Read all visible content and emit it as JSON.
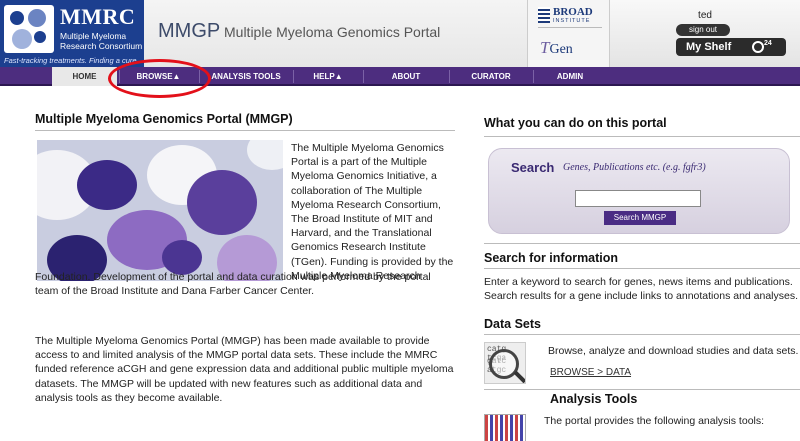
{
  "header": {
    "logo": {
      "title": "MMRC",
      "subtitle": "Multiple Myeloma Research Consortium",
      "tagline": "Fast-tracking treatments. Finding a cure."
    },
    "site_code": "MMGP",
    "site_name": "Multiple Myeloma Genomics Portal",
    "partners": {
      "broad_title": "BROAD",
      "broad_sub": "INSTITUTE",
      "tgen_prefix": "T",
      "tgen_suffix": "Gen"
    },
    "user": {
      "name": "ted",
      "signout_label": "sign out",
      "shelf_label": "My Shelf",
      "shelf_count": "24"
    }
  },
  "nav": {
    "items": [
      {
        "label": "HOME",
        "active": true
      },
      {
        "label": "BROWSE▲"
      },
      {
        "label": "ANALYSIS TOOLS"
      },
      {
        "label": "HELP▲"
      },
      {
        "label": "ABOUT"
      },
      {
        "label": "CURATOR"
      },
      {
        "label": "ADMIN"
      }
    ]
  },
  "main": {
    "title": "Multiple Myeloma Genomics Portal (MMGP)",
    "intro_side": "The Multiple Myeloma Genomics Portal is a part of the Multiple Myeloma Genomics Initiative, a collaboration of The Multiple Myeloma Research Consortium, The Broad Institute of MIT and Harvard, and the Translational Genomics Research Institute (TGen). Funding is provided by the Multiple Myeloma Research",
    "intro_cont": "Foundation. Development of the portal and data curation was performed by the portal team of the Broad Institute and Dana Farber Cancer Center.",
    "para2": "The Multiple Myeloma Genomics Portal (MMGP) has been made available to provide access to and limited analysis of the MMGP portal data sets. These include the MMRC funded reference aCGH and gene expression data and additional public multiple myeloma datasets. The MMGP will be updated with new features such as additional data and analysis tools as they become available."
  },
  "right": {
    "title": "What you can do on this portal",
    "search": {
      "label": "Search",
      "hint": "Genes, Publications etc. (e.g. fgfr3)",
      "value": "",
      "button": "Search MMGP"
    },
    "search_info": {
      "title": "Search for information",
      "text": "Enter a keyword to search for genes, news items and publications. Search results for a gene include links to annotations and analyses."
    },
    "datasets": {
      "title": "Data Sets",
      "text": "Browse, analyze and download studies and data sets.",
      "link": "BROWSE  > DATA"
    },
    "analysis_tools": {
      "title": "Analysis Tools",
      "text": "The portal provides the following analysis tools:"
    }
  },
  "icons": [
    "mmrc-logo",
    "broad-logo",
    "tgen-logo",
    "my-shelf-icon",
    "magnifier-icon",
    "analysis-tools-icon"
  ],
  "colors": {
    "nav": "#4d2d7f",
    "logo_bg": "#1c3f8f",
    "annotation": "#e3101a",
    "button": "#4a2c84"
  }
}
